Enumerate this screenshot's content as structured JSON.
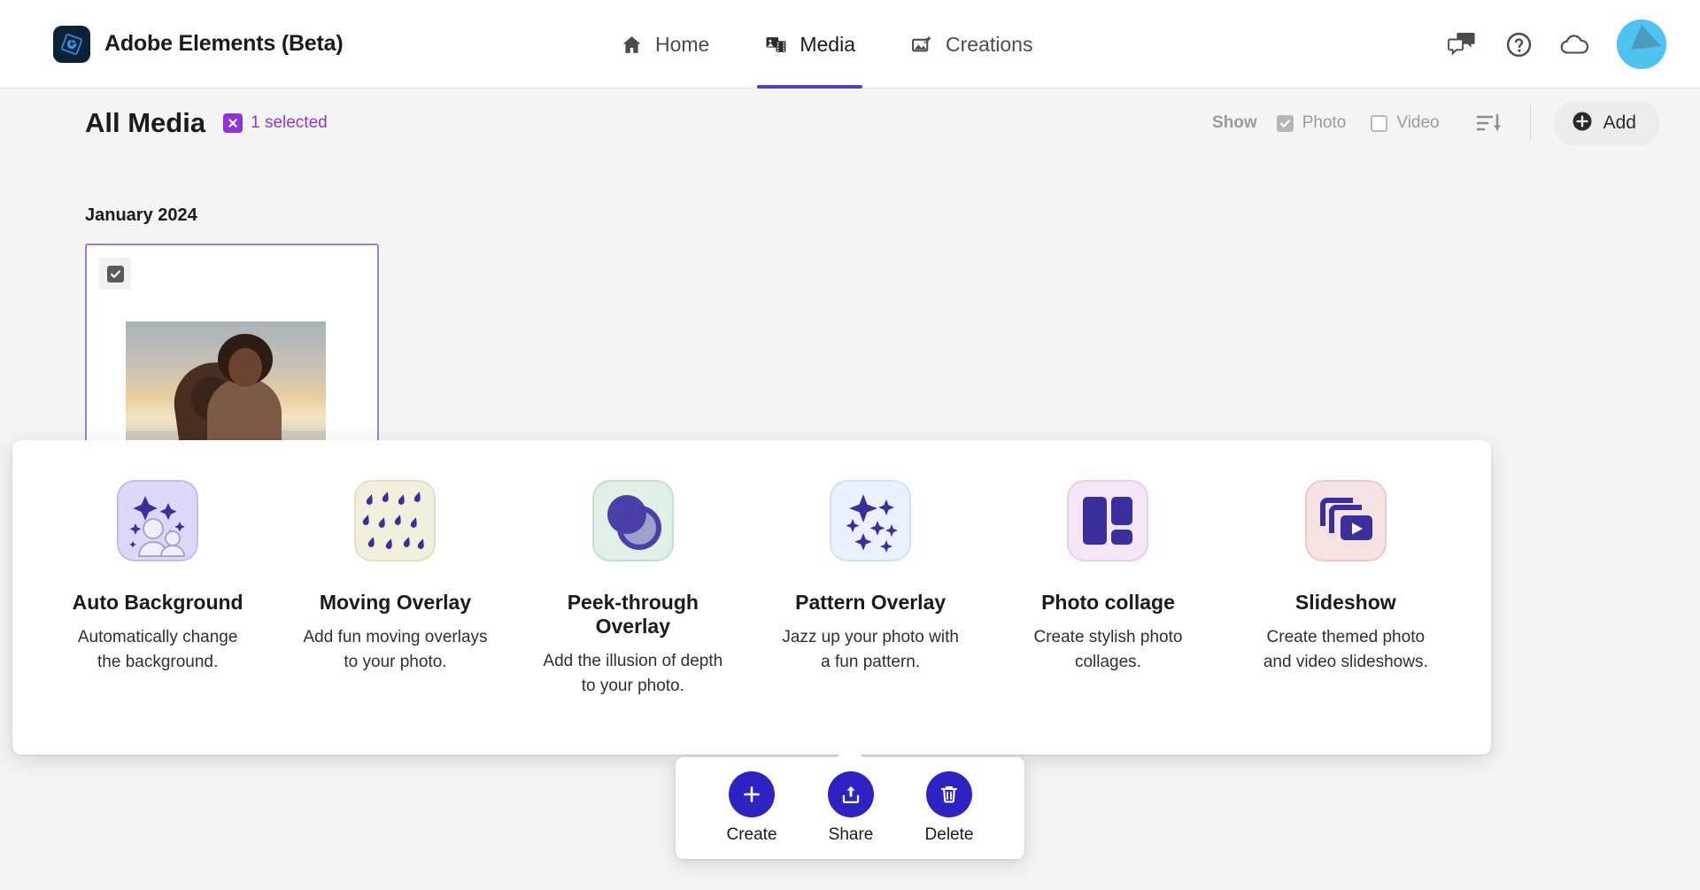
{
  "app": {
    "title": "Adobe Elements (Beta)",
    "logo_icon": "aperture-diamond-logo"
  },
  "nav": {
    "items": [
      {
        "label": "Home",
        "icon": "home-icon",
        "active": false
      },
      {
        "label": "Media",
        "icon": "media-icon",
        "active": true
      },
      {
        "label": "Creations",
        "icon": "creations-sparkle-icon",
        "active": false
      }
    ]
  },
  "top_right": {
    "icons": [
      {
        "name": "chat-bubbles-icon"
      },
      {
        "name": "help-circle-icon"
      },
      {
        "name": "cloud-icon"
      }
    ],
    "avatar": "user-avatar"
  },
  "content_header": {
    "page_title": "All Media",
    "selection_badge_icon": "close-x-icon",
    "selection_text": "1 selected",
    "show_label": "Show",
    "filters": [
      {
        "label": "Photo",
        "checked": true
      },
      {
        "label": "Video",
        "checked": false
      }
    ],
    "sort_icon": "sort-descending-icon",
    "add_label": "Add",
    "add_icon": "plus-circle-icon"
  },
  "media": {
    "month_label": "January 2024",
    "card": {
      "selected": true,
      "checkbox_icon": "checkmark-icon",
      "thumbnail_alt": "couple-at-sunset-photo"
    }
  },
  "creations_panel": {
    "options": [
      {
        "title": "Auto Background",
        "desc": "Automatically change the background.",
        "icon": "auto-background-icon"
      },
      {
        "title": "Moving Overlay",
        "desc": "Add fun moving overlays to your photo.",
        "icon": "moving-overlay-rain-icon"
      },
      {
        "title": "Peek-through Overlay",
        "desc": "Add the illusion of depth to your photo.",
        "icon": "peek-through-circles-icon"
      },
      {
        "title": "Pattern Overlay",
        "desc": "Jazz up your photo with a fun pattern.",
        "icon": "pattern-sparkles-icon"
      },
      {
        "title": "Photo collage",
        "desc": "Create stylish photo collages.",
        "icon": "photo-collage-grid-icon"
      },
      {
        "title": "Slideshow",
        "desc": "Create themed photo and video slideshows.",
        "icon": "slideshow-play-icon"
      }
    ]
  },
  "action_bar": {
    "actions": [
      {
        "label": "Create",
        "icon": "plus-icon"
      },
      {
        "label": "Share",
        "icon": "share-upload-icon"
      },
      {
        "label": "Delete",
        "icon": "trash-icon"
      }
    ]
  },
  "colors": {
    "accent_purple": "#4b3fd4",
    "selection_purple": "#8d3ad4",
    "action_blue": "#2d23c4",
    "card_border": "#9a7fe0",
    "page_bg": "#f4f4f4"
  }
}
